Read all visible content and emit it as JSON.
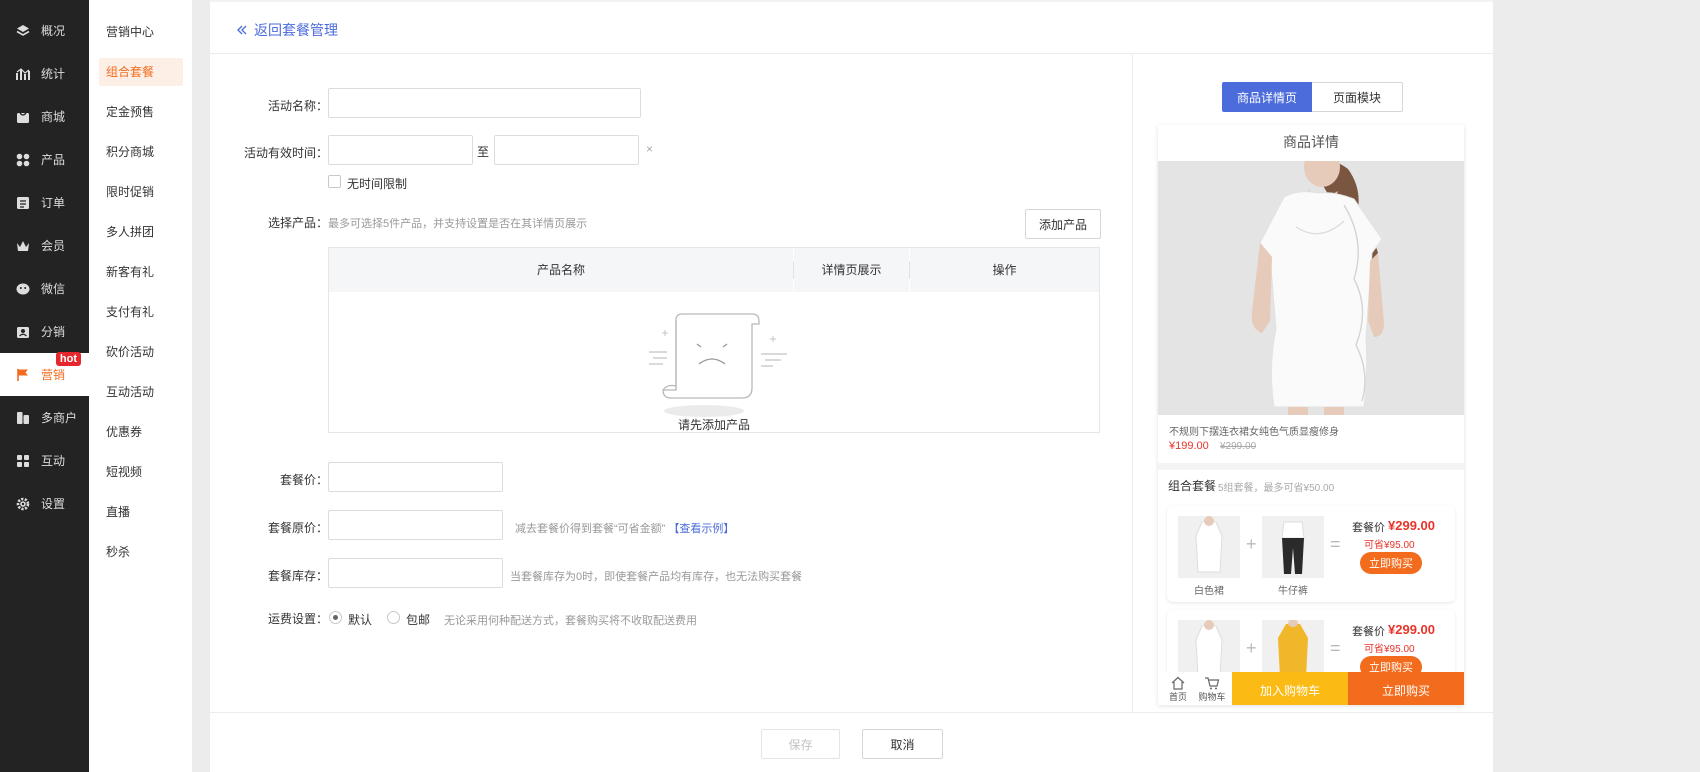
{
  "sidebar": {
    "items": [
      {
        "label": "概况",
        "icon": "layers-icon"
      },
      {
        "label": "统计",
        "icon": "chart-icon"
      },
      {
        "label": "商城",
        "icon": "store-icon"
      },
      {
        "label": "产品",
        "icon": "grid-icon"
      },
      {
        "label": "订单",
        "icon": "order-icon"
      },
      {
        "label": "会员",
        "icon": "crown-icon"
      },
      {
        "label": "微信",
        "icon": "wechat-icon"
      },
      {
        "label": "分销",
        "icon": "distribution-icon"
      },
      {
        "label": "营销",
        "icon": "flag-icon",
        "active": true,
        "badge": "hot"
      },
      {
        "label": "多商户",
        "icon": "merchant-icon"
      },
      {
        "label": "互动",
        "icon": "interact-icon"
      },
      {
        "label": "设置",
        "icon": "gear-icon"
      }
    ]
  },
  "submenu": {
    "items": [
      "营销中心",
      "组合套餐",
      "定金预售",
      "积分商城",
      "限时促销",
      "多人拼团",
      "新客有礼",
      "支付有礼",
      "砍价活动",
      "互动活动",
      "优惠券",
      "短视频",
      "直播",
      "秒杀"
    ],
    "active_index": 1
  },
  "header": {
    "back_label": "返回套餐管理"
  },
  "form": {
    "name_label": "活动名称：",
    "time_label": "活动有效时间：",
    "time_sep": "至",
    "clear_glyph": "×",
    "no_limit_label": "无时间限制",
    "select_label": "选择产品：",
    "select_hint": "最多可选择5件产品，并支持设置是否在其详情页展示",
    "add_button": "添加产品",
    "table_headers": [
      "产品名称",
      "详情页展示",
      "操作"
    ],
    "empty_text": "请先添加产品",
    "price_label": "套餐价：",
    "orig_price_label": "套餐原价：",
    "orig_price_hint": "减去套餐价得到套餐“可省金额”",
    "orig_price_link": "【查看示例】",
    "stock_label": "套餐库存：",
    "stock_hint": "当套餐库存为0时，即使套餐产品均有库存，也无法购买套餐",
    "shipping_label": "运费设置：",
    "shipping_options": [
      "默认",
      "包邮"
    ],
    "shipping_hint": "无论采用何种配送方式，套餐购买将不收取配送费用"
  },
  "preview": {
    "tabs": [
      "商品详情页",
      "页面模块"
    ],
    "phone_title": "商品详情",
    "product_title": "不规则下摆连衣裙女纯色气质显瘦修身",
    "product_price": "¥199.00",
    "product_orig_price": "¥299.00",
    "combo_title": "组合套餐",
    "combo_subtitle": "5组套餐，最多可省¥50.00",
    "packages": [
      {
        "items": [
          "白色裙",
          "牛仔裤"
        ],
        "price_label": "套餐价",
        "price": "¥299.00",
        "save": "可省¥95.00",
        "buy": "立即购买"
      },
      {
        "items": [
          "",
          ""
        ],
        "price_label": "套餐价",
        "price": "¥299.00",
        "save": "可省¥95.00",
        "buy": "立即购买"
      }
    ],
    "bottom": {
      "home": "首页",
      "cart_icon_label": "购物车",
      "add_cart": "加入购物车",
      "buy_now": "立即购买"
    }
  },
  "footer": {
    "save": "保存",
    "cancel": "取消"
  },
  "colors": {
    "accent": "#4c6cdb",
    "brand_orange": "#f36c1d",
    "yellow": "#fbbb14",
    "sidebar_bg": "#232323"
  }
}
